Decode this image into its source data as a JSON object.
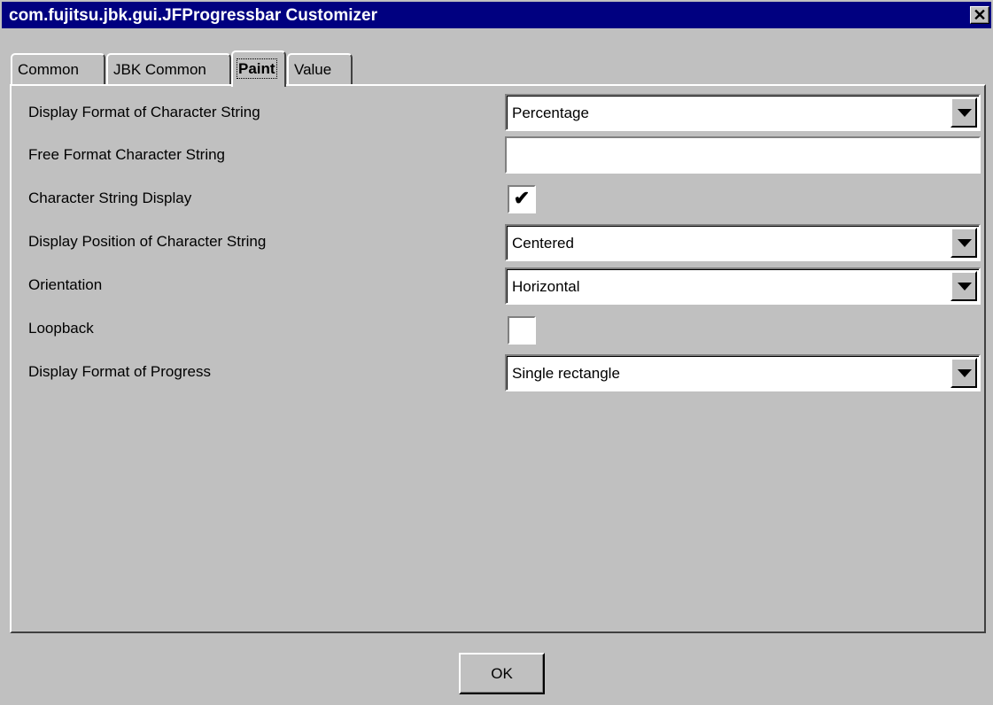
{
  "window": {
    "title": "com.fujitsu.jbk.gui.JFProgressbar Customizer",
    "close_glyph": "✕"
  },
  "tabs": [
    {
      "label": "Common",
      "active": false
    },
    {
      "label": "JBK Common",
      "active": false
    },
    {
      "label": "Paint",
      "active": true
    },
    {
      "label": "Value",
      "active": false
    }
  ],
  "properties": [
    {
      "label": "Display Format of Character String",
      "type": "combo",
      "value": "Percentage"
    },
    {
      "label": "Free Format Character String",
      "type": "text",
      "value": ""
    },
    {
      "label": "Character String Display",
      "type": "checkbox",
      "checked": true,
      "check_glyph": "✔"
    },
    {
      "label": "Display Position of Character String",
      "type": "combo",
      "value": "Centered"
    },
    {
      "label": "Orientation",
      "type": "combo",
      "value": "Horizontal"
    },
    {
      "label": "Loopback",
      "type": "checkbox",
      "checked": false,
      "check_glyph": ""
    },
    {
      "label": "Display Format of Progress",
      "type": "combo",
      "value": "Single rectangle"
    }
  ],
  "buttons": {
    "ok_label": "OK"
  },
  "colors": {
    "title_bar": "#000080",
    "face": "#c0c0c0"
  }
}
